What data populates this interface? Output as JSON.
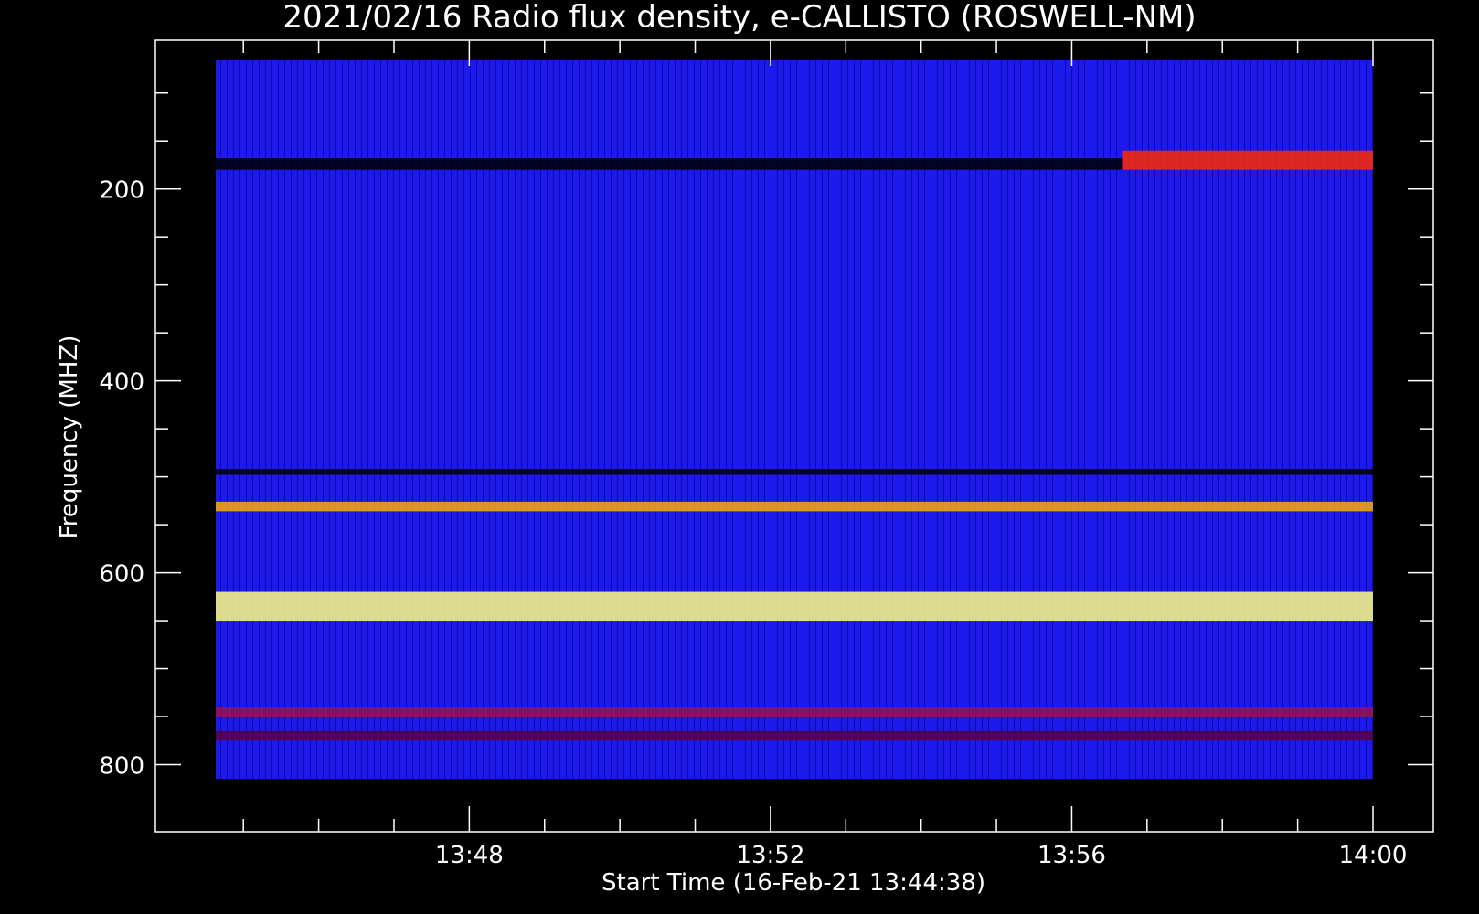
{
  "chart_data": {
    "type": "heatmap",
    "title": "2021/02/16  Radio flux density, e-CALLISTO (ROSWELL-NM)",
    "xlabel": "Start Time (16-Feb-21 13:44:38)",
    "ylabel": "Frequency (MHZ)",
    "x_ticks": [
      "13:48",
      "13:52",
      "13:56",
      "14:00"
    ],
    "y_ticks": [
      "200",
      "400",
      "600",
      "800"
    ],
    "x_range": [
      "13:44:38",
      "14:00:00"
    ],
    "y_range_mhz": [
      45,
      870
    ],
    "colors": {
      "background": "#000000",
      "spectrum": "#1a1af0",
      "dark": "#000000",
      "hot": "#ff2a00",
      "bright": "#ffff80"
    },
    "bands": [
      {
        "f1": 160,
        "f2": 180,
        "t1": "13:56:40",
        "t2": "14:00:00",
        "color": "#ff2a00"
      },
      {
        "f1": 168,
        "f2": 180,
        "t1": "13:44:38",
        "t2": "13:56:40",
        "color": "#000000"
      },
      {
        "f1": 492,
        "f2": 498,
        "t1": "13:44:38",
        "t2": "14:00:00",
        "color": "#000000"
      },
      {
        "f1": 526,
        "f2": 536,
        "t1": "13:44:38",
        "t2": "14:00:00",
        "color": "#ffaa00"
      },
      {
        "f1": 620,
        "f2": 650,
        "t1": "13:44:38",
        "t2": "14:00:00",
        "color": "#ffff80"
      },
      {
        "f1": 740,
        "f2": 750,
        "t1": "13:44:38",
        "t2": "14:00:00",
        "color": "#9a1050"
      },
      {
        "f1": 765,
        "f2": 775,
        "t1": "13:44:38",
        "t2": "14:00:00",
        "color": "#5a0040"
      }
    ]
  }
}
